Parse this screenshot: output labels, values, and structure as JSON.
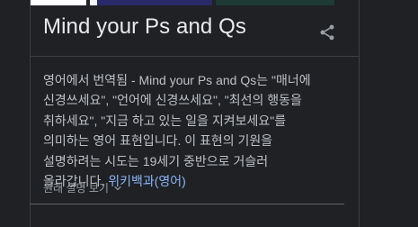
{
  "panel": {
    "title": "Mind your Ps and Qs",
    "description_prefix": "영어에서 번역됨 - Mind your Ps and Qs는 \"매너에 신경쓰세요\", \"언어에 신경쓰세요\", \"최선의 행동을 취하세요\", \"지금 하고 있는 일을 지켜보세요\"를 의미하는 영어 표현입니다. 이 표현의 기원을 설명하려는 시도는 19세기 중반으로 거슬러 올라갑니다. ",
    "source_link": "위키백과(영어)",
    "show_original_label": "원래 설명 보기"
  },
  "icons": {
    "share": "share-icon",
    "expand": "chevron-down-icon"
  },
  "colors": {
    "background": "#202124",
    "title": "#e8eaed",
    "body_text": "#bdc1c6",
    "link": "#8ab4f8",
    "muted": "#9aa0a6",
    "divider": "#3c4043"
  }
}
